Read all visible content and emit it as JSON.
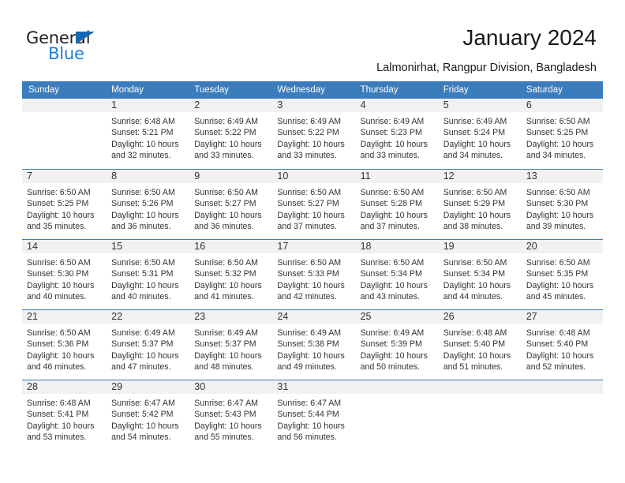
{
  "brand": {
    "name_primary": "General",
    "name_secondary": "Blue",
    "color_primary": "#231f20",
    "color_secondary": "#1b7fd4",
    "triangle_color": "#1268b3"
  },
  "header": {
    "title": "January 2024",
    "subtitle": "Lalmonirhat, Rangpur Division, Bangladesh"
  },
  "calendar": {
    "header_bg": "#3b7cbd",
    "band_bg": "#f1f1f1",
    "weekdays": [
      "Sunday",
      "Monday",
      "Tuesday",
      "Wednesday",
      "Thursday",
      "Friday",
      "Saturday"
    ],
    "weeks": [
      [
        {
          "day": "",
          "lines": []
        },
        {
          "day": "1",
          "lines": [
            "Sunrise: 6:48 AM",
            "Sunset: 5:21 PM",
            "Daylight: 10 hours",
            "and 32 minutes."
          ]
        },
        {
          "day": "2",
          "lines": [
            "Sunrise: 6:49 AM",
            "Sunset: 5:22 PM",
            "Daylight: 10 hours",
            "and 33 minutes."
          ]
        },
        {
          "day": "3",
          "lines": [
            "Sunrise: 6:49 AM",
            "Sunset: 5:22 PM",
            "Daylight: 10 hours",
            "and 33 minutes."
          ]
        },
        {
          "day": "4",
          "lines": [
            "Sunrise: 6:49 AM",
            "Sunset: 5:23 PM",
            "Daylight: 10 hours",
            "and 33 minutes."
          ]
        },
        {
          "day": "5",
          "lines": [
            "Sunrise: 6:49 AM",
            "Sunset: 5:24 PM",
            "Daylight: 10 hours",
            "and 34 minutes."
          ]
        },
        {
          "day": "6",
          "lines": [
            "Sunrise: 6:50 AM",
            "Sunset: 5:25 PM",
            "Daylight: 10 hours",
            "and 34 minutes."
          ]
        }
      ],
      [
        {
          "day": "7",
          "lines": [
            "Sunrise: 6:50 AM",
            "Sunset: 5:25 PM",
            "Daylight: 10 hours",
            "and 35 minutes."
          ]
        },
        {
          "day": "8",
          "lines": [
            "Sunrise: 6:50 AM",
            "Sunset: 5:26 PM",
            "Daylight: 10 hours",
            "and 36 minutes."
          ]
        },
        {
          "day": "9",
          "lines": [
            "Sunrise: 6:50 AM",
            "Sunset: 5:27 PM",
            "Daylight: 10 hours",
            "and 36 minutes."
          ]
        },
        {
          "day": "10",
          "lines": [
            "Sunrise: 6:50 AM",
            "Sunset: 5:27 PM",
            "Daylight: 10 hours",
            "and 37 minutes."
          ]
        },
        {
          "day": "11",
          "lines": [
            "Sunrise: 6:50 AM",
            "Sunset: 5:28 PM",
            "Daylight: 10 hours",
            "and 37 minutes."
          ]
        },
        {
          "day": "12",
          "lines": [
            "Sunrise: 6:50 AM",
            "Sunset: 5:29 PM",
            "Daylight: 10 hours",
            "and 38 minutes."
          ]
        },
        {
          "day": "13",
          "lines": [
            "Sunrise: 6:50 AM",
            "Sunset: 5:30 PM",
            "Daylight: 10 hours",
            "and 39 minutes."
          ]
        }
      ],
      [
        {
          "day": "14",
          "lines": [
            "Sunrise: 6:50 AM",
            "Sunset: 5:30 PM",
            "Daylight: 10 hours",
            "and 40 minutes."
          ]
        },
        {
          "day": "15",
          "lines": [
            "Sunrise: 6:50 AM",
            "Sunset: 5:31 PM",
            "Daylight: 10 hours",
            "and 40 minutes."
          ]
        },
        {
          "day": "16",
          "lines": [
            "Sunrise: 6:50 AM",
            "Sunset: 5:32 PM",
            "Daylight: 10 hours",
            "and 41 minutes."
          ]
        },
        {
          "day": "17",
          "lines": [
            "Sunrise: 6:50 AM",
            "Sunset: 5:33 PM",
            "Daylight: 10 hours",
            "and 42 minutes."
          ]
        },
        {
          "day": "18",
          "lines": [
            "Sunrise: 6:50 AM",
            "Sunset: 5:34 PM",
            "Daylight: 10 hours",
            "and 43 minutes."
          ]
        },
        {
          "day": "19",
          "lines": [
            "Sunrise: 6:50 AM",
            "Sunset: 5:34 PM",
            "Daylight: 10 hours",
            "and 44 minutes."
          ]
        },
        {
          "day": "20",
          "lines": [
            "Sunrise: 6:50 AM",
            "Sunset: 5:35 PM",
            "Daylight: 10 hours",
            "and 45 minutes."
          ]
        }
      ],
      [
        {
          "day": "21",
          "lines": [
            "Sunrise: 6:50 AM",
            "Sunset: 5:36 PM",
            "Daylight: 10 hours",
            "and 46 minutes."
          ]
        },
        {
          "day": "22",
          "lines": [
            "Sunrise: 6:49 AM",
            "Sunset: 5:37 PM",
            "Daylight: 10 hours",
            "and 47 minutes."
          ]
        },
        {
          "day": "23",
          "lines": [
            "Sunrise: 6:49 AM",
            "Sunset: 5:37 PM",
            "Daylight: 10 hours",
            "and 48 minutes."
          ]
        },
        {
          "day": "24",
          "lines": [
            "Sunrise: 6:49 AM",
            "Sunset: 5:38 PM",
            "Daylight: 10 hours",
            "and 49 minutes."
          ]
        },
        {
          "day": "25",
          "lines": [
            "Sunrise: 6:49 AM",
            "Sunset: 5:39 PM",
            "Daylight: 10 hours",
            "and 50 minutes."
          ]
        },
        {
          "day": "26",
          "lines": [
            "Sunrise: 6:48 AM",
            "Sunset: 5:40 PM",
            "Daylight: 10 hours",
            "and 51 minutes."
          ]
        },
        {
          "day": "27",
          "lines": [
            "Sunrise: 6:48 AM",
            "Sunset: 5:40 PM",
            "Daylight: 10 hours",
            "and 52 minutes."
          ]
        }
      ],
      [
        {
          "day": "28",
          "lines": [
            "Sunrise: 6:48 AM",
            "Sunset: 5:41 PM",
            "Daylight: 10 hours",
            "and 53 minutes."
          ]
        },
        {
          "day": "29",
          "lines": [
            "Sunrise: 6:47 AM",
            "Sunset: 5:42 PM",
            "Daylight: 10 hours",
            "and 54 minutes."
          ]
        },
        {
          "day": "30",
          "lines": [
            "Sunrise: 6:47 AM",
            "Sunset: 5:43 PM",
            "Daylight: 10 hours",
            "and 55 minutes."
          ]
        },
        {
          "day": "31",
          "lines": [
            "Sunrise: 6:47 AM",
            "Sunset: 5:44 PM",
            "Daylight: 10 hours",
            "and 56 minutes."
          ]
        },
        {
          "day": "",
          "lines": []
        },
        {
          "day": "",
          "lines": []
        },
        {
          "day": "",
          "lines": []
        }
      ]
    ]
  }
}
